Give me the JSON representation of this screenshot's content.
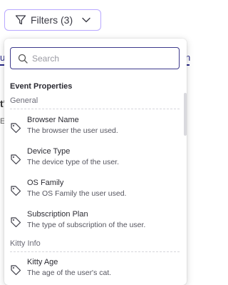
{
  "filters_button": {
    "label": "Filters (3)"
  },
  "search": {
    "placeholder": "Search",
    "value": ""
  },
  "panel": {
    "section_title": "Event Properties",
    "groups": [
      {
        "label": "General",
        "items": [
          {
            "name": "Browser Name",
            "description": "The browser the user used."
          },
          {
            "name": "Device Type",
            "description": "The device type of the user."
          },
          {
            "name": "OS Family",
            "description": "The OS Family the user used."
          },
          {
            "name": "Subscription Plan",
            "description": "The type of subscription of the user."
          }
        ]
      },
      {
        "label": "Kitty Info",
        "items": [
          {
            "name": "Kitty Age",
            "description": "The age of the user's cat."
          }
        ]
      }
    ]
  },
  "background": {
    "fragment_left": "u",
    "fragment_right": "n",
    "fragment_mid": "t'",
    "fragment_e": "E"
  },
  "icons": {
    "funnel": "funnel-icon",
    "chevron": "chevron-down-icon",
    "search": "search-icon",
    "tag": "tag-icon"
  },
  "colors": {
    "accent_border": "#b9a9ff",
    "search_border": "#3e3a8c"
  }
}
